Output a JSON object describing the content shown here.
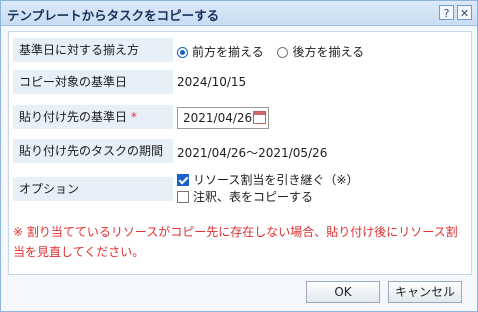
{
  "dialog": {
    "title": "テンプレートからタスクをコピーする",
    "help_label": "?",
    "close_label": "✕"
  },
  "form": {
    "align_label": "基準日に対する揃え方",
    "align_options": [
      {
        "label": "前方を揃える",
        "selected": true
      },
      {
        "label": "後方を揃える",
        "selected": false
      }
    ],
    "source_date_label": "コピー対象の基準日",
    "source_date_value": "2024/10/15",
    "dest_date_label": "貼り付け先の基準日",
    "dest_date_required": "*",
    "dest_date_value": "2021/04/26",
    "period_label": "貼り付け先のタスクの期間",
    "period_value": "2021/04/26〜2021/05/26",
    "options_label": "オプション",
    "options": [
      {
        "label": "リソース割当を引き継ぐ（※）",
        "checked": true
      },
      {
        "label": "注釈、表をコピーする",
        "checked": false
      }
    ]
  },
  "note": "※ 割り当てているリソースがコピー先に存在しない場合、貼り付け後にリソース割当を見直してください。",
  "buttons": {
    "ok": "OK",
    "cancel": "キャンセル"
  },
  "colors": {
    "accent": "#1a62c7",
    "required": "#e03030",
    "label_bg": "#e7eff8"
  }
}
